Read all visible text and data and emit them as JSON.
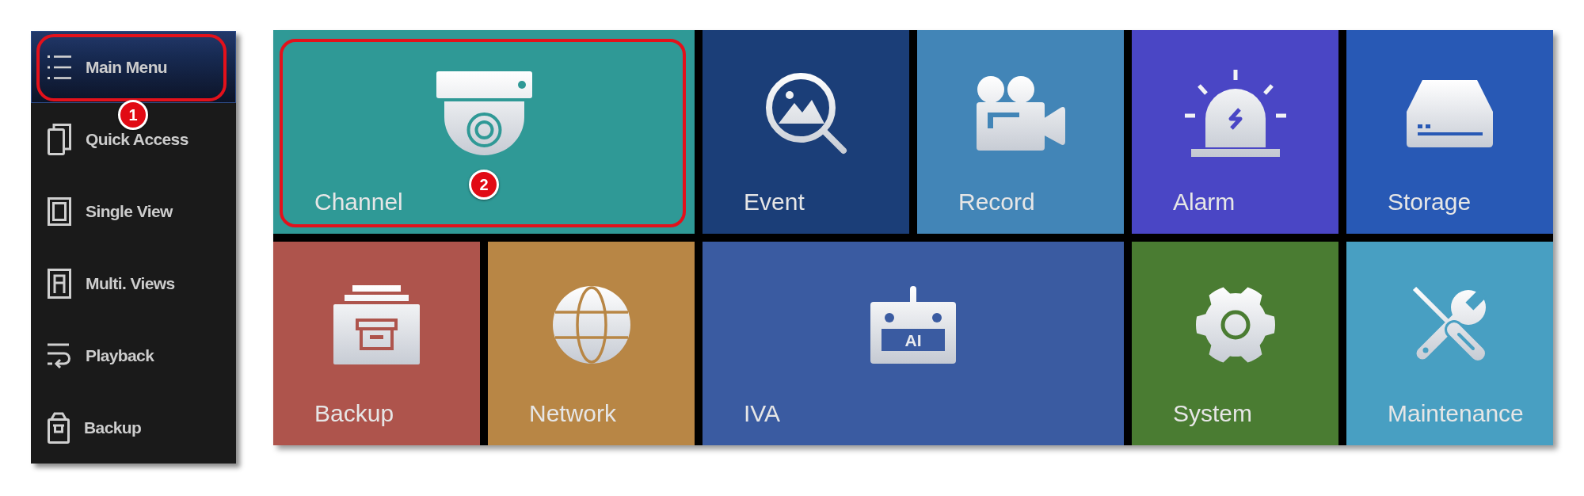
{
  "sidebar": {
    "items": [
      {
        "label": "Main Menu",
        "selected": true,
        "callout": "1"
      },
      {
        "label": "Quick Access",
        "selected": false
      },
      {
        "label": "Single View",
        "selected": false
      },
      {
        "label": "Multi. Views",
        "selected": false
      },
      {
        "label": "Playback",
        "selected": false
      },
      {
        "label": "Backup",
        "selected": false
      }
    ]
  },
  "tiles": [
    {
      "label": "Channel",
      "color": "#2f9996",
      "callout": "2"
    },
    {
      "label": "Event",
      "color": "#1b3e78"
    },
    {
      "label": "Record",
      "color": "#4285b7"
    },
    {
      "label": "Alarm",
      "color": "#4a46c5"
    },
    {
      "label": "Storage",
      "color": "#2859b5"
    },
    {
      "label": "Backup",
      "color": "#ae544c"
    },
    {
      "label": "Network",
      "color": "#b88645"
    },
    {
      "label": "IVA",
      "color": "#3a5ba1",
      "icon_text": "AI"
    },
    {
      "label": "System",
      "color": "#4a7c32"
    },
    {
      "label": "Maintenance",
      "color": "#489fc2"
    }
  ]
}
